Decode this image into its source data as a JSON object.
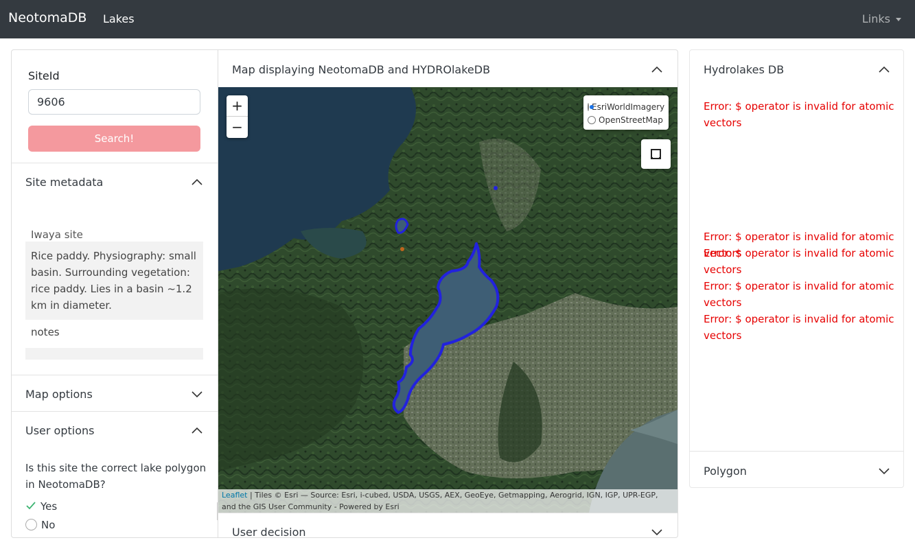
{
  "navbar": {
    "brand": "NeotomaDB",
    "lakes": "Lakes",
    "links": "Links"
  },
  "sidebar": {
    "siteid_label": "SiteId",
    "siteid_value": "9606",
    "search_button": "Search!",
    "site_metadata_header": "Site metadata",
    "site_name": "Iwaya site",
    "site_description": "Rice paddy. Physiography: small basin. Surrounding vegetation: rice paddy. Lies in a basin ~1.2 km in diameter.",
    "notes_label": "notes",
    "map_options_header": "Map options",
    "user_options_header": "User options",
    "question": "Is this site the correct lake polygon in NeotomaDB?",
    "options": [
      {
        "label": "Yes",
        "selected": true
      },
      {
        "label": "No",
        "selected": false
      }
    ]
  },
  "map": {
    "header": "Map displaying NeotomaDB and HYDROlakeDB",
    "zoom_in": "+",
    "zoom_out": "−",
    "layers": [
      {
        "label": "EsriWorldImagery",
        "selected": true
      },
      {
        "label": "OpenStreetMap",
        "selected": false
      }
    ],
    "attribution_link": "Leaflet",
    "attribution_text": "| Tiles © Esri — Source: Esri, i-cubed, USDA, USGS, AEX, GeoEye, Getmapping, Aerogrid, IGN, IGP, UPR-EGP, and the GIS User Community - Powered by Esri",
    "polygon_color": "#2222dd",
    "user_decision_header": "User decision"
  },
  "right": {
    "header": "Hydrolakes DB",
    "error_label": "Error:",
    "error_message": "$ operator is invalid for atomic vectors",
    "polygon_header": "Polygon",
    "error_color": "#e60000"
  }
}
